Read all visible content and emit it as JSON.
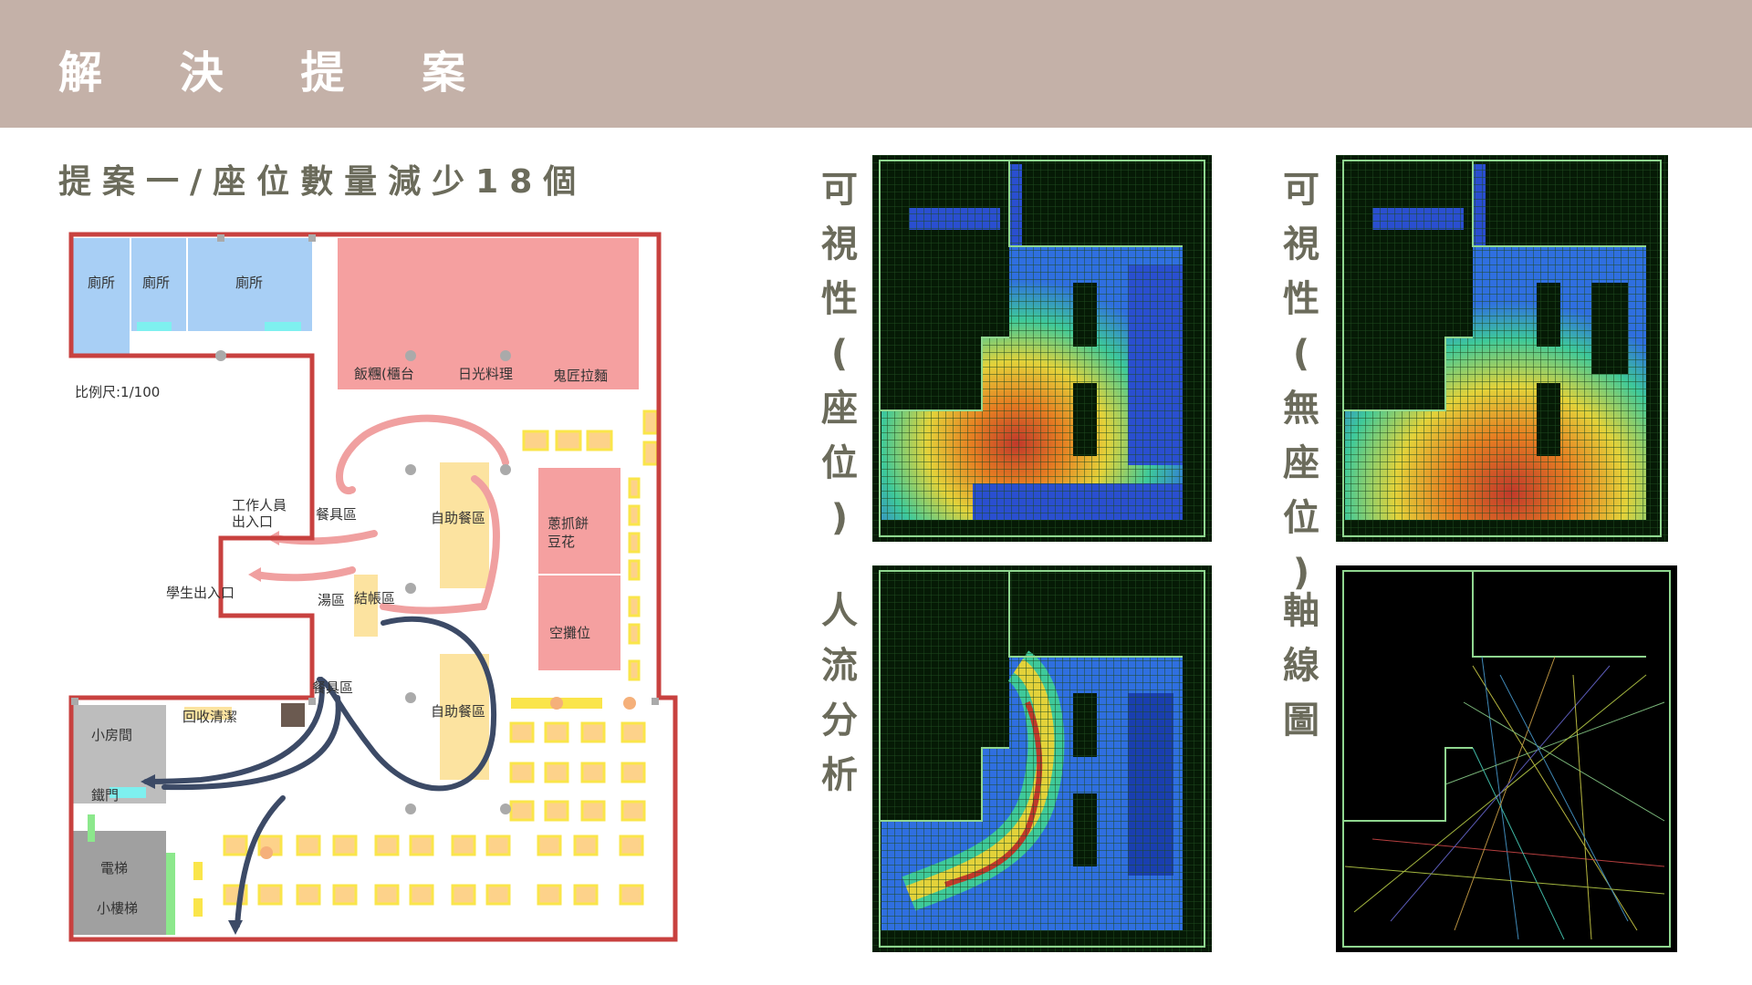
{
  "header": {
    "title": "解 決 提 案"
  },
  "subtitle": "提案一/座位數量減少18個",
  "floor_plan": {
    "scale": "比例尺:1/100",
    "rooms": {
      "toilet_1": "廁所",
      "toilet_2": "廁所",
      "toilet_3": "廁所",
      "rice_ball": "飯糰(櫃台",
      "japanese": "日光料理",
      "ramen": "鬼匠拉麵",
      "staff_entrance_1": "工作人員",
      "staff_entrance_2": "出入口",
      "tableware_top": "餐具區",
      "buffet_top": "自助餐區",
      "scallion_1": "蔥抓餅",
      "scallion_2": "豆花",
      "student_entrance": "學生出入口",
      "soup": "湯區",
      "checkout": "結帳區",
      "empty_stall": "空攤位",
      "tableware_bottom": "餐具區",
      "buffet_bottom": "自助餐區",
      "small_room": "小房間",
      "recycle": "回收清潔",
      "iron_door": "鐵門",
      "elevator": "電梯",
      "stairs": "小樓梯"
    },
    "colors": {
      "wall": "#c8413f",
      "toilet": "#a8cff5",
      "stall": "#f5a0a0",
      "buffet": "#fce3a0",
      "table": "#fdd28a",
      "chair": "#fae54a"
    }
  },
  "analysis": {
    "visibility_seat_label": [
      "可",
      "視",
      "性",
      "(",
      "座",
      "位",
      ")"
    ],
    "visibility_noseat_label": [
      "可",
      "視",
      "性",
      "(",
      "無",
      "座",
      "位",
      ")"
    ],
    "flow_label": [
      "人",
      "流",
      "分",
      "析"
    ],
    "axial_label": [
      "軸",
      "線",
      "圖"
    ]
  }
}
